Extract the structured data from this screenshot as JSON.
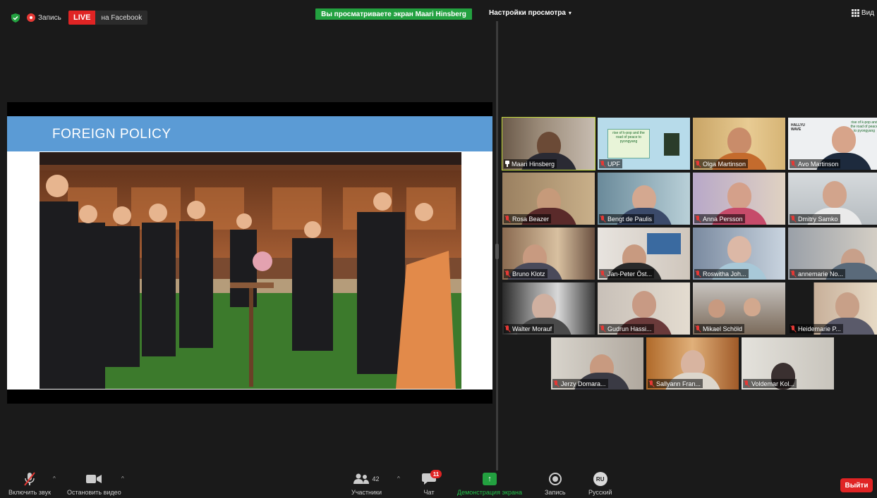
{
  "topbar": {
    "recording_label": "Запись",
    "live_label": "LIVE",
    "live_platform": "на Facebook",
    "share_banner": "Вы просматриваете экран Maari Hinsberg",
    "view_settings_label": "Настройки просмотра",
    "view_button_label": "Вид"
  },
  "slide": {
    "title": "FOREIGN POLICY"
  },
  "participants": [
    {
      "name": "Maari Hinsberg",
      "pinned": true,
      "active": true
    },
    {
      "name": "UPF"
    },
    {
      "name": "Olga Martinson"
    },
    {
      "name": "Avo Martinson"
    },
    {
      "name": "Rosa Beazer"
    },
    {
      "name": "Bengt de Paulis"
    },
    {
      "name": "Anna Persson"
    },
    {
      "name": "Dmitry Samko"
    },
    {
      "name": "Bruno Klotz"
    },
    {
      "name": "Jan-Peter Öst..."
    },
    {
      "name": "Roswitha Joh..."
    },
    {
      "name": "annemarie No..."
    },
    {
      "name": "Walter Morauf"
    },
    {
      "name": "Gudrun Hassi..."
    },
    {
      "name": "Mikael Schöld"
    },
    {
      "name": "Heidemarie P..."
    },
    {
      "name": "Jerzy Domara..."
    },
    {
      "name": "Sallyann Fran..."
    },
    {
      "name": "Voldemar Kol..."
    }
  ],
  "upf_tile_text": "rise of k-pop and the road of peace to pyongyang",
  "avo_tile_text": "rise of k-pop and the road of peace to pyongyang",
  "avo_tile_logo": "HALLYU WAVE",
  "toolbar": {
    "unmute_label": "Включить звук",
    "stop_video_label": "Остановить видео",
    "participants_label": "Участники",
    "participants_count": "42",
    "chat_label": "Чат",
    "chat_badge": "11",
    "share_label": "Демонстрация экрана",
    "record_label": "Запись",
    "language_label": "Русский",
    "language_code": "RU",
    "exit_label": "Выйти"
  },
  "colors": {
    "accent_green": "#23a140",
    "live_red": "#e02424",
    "slide_header_blue": "#5b9bd5",
    "active_speaker_outline": "#c4dc3c"
  }
}
